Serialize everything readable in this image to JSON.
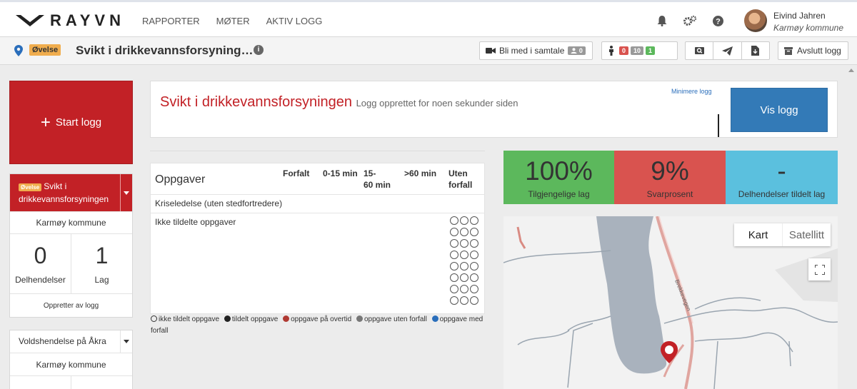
{
  "header": {
    "logo_text": "RAYVN",
    "nav": [
      "RAPPORTER",
      "MØTER",
      "AKTIV LOGG"
    ],
    "user_name": "Eivind Jahren",
    "user_org": "Karmøy kommune"
  },
  "subbar": {
    "badge": "Øvelse",
    "title": "Svikt i drikkevannsforsyning…",
    "join_label": "Bli med i samtale",
    "join_count": "0",
    "counts": [
      "0",
      "10",
      "1"
    ],
    "close_label": "Avslutt logg"
  },
  "left": {
    "start_label": "Start logg",
    "card1": {
      "badge": "Øvelse",
      "title": "Svikt i drikkevannsforsyningen",
      "org": "Karmøy kommune",
      "stats": [
        {
          "value": "0",
          "label": "Delhendelser"
        },
        {
          "value": "1",
          "label": "Lag"
        }
      ],
      "footer": "Oppretter av logg"
    },
    "card2": {
      "title": "Voldshendelse på Åkra",
      "org": "Karmøy kommune"
    }
  },
  "log_header": {
    "title": "Svikt i drikkevannsforsyningen",
    "subtitle": "Logg opprettet for noen sekunder siden",
    "minimize": "Minimere logg",
    "open_label": "Vis logg"
  },
  "tasks": {
    "title": "Oppgaver",
    "columns": [
      "Forfalt",
      "0-15 min",
      "15-\n60 min",
      ">60 min",
      "Uten\nforfall"
    ],
    "rows": [
      "Kriseledelse (uten stedfortredere)",
      "Ikke tildelte oppgaver"
    ],
    "legend": [
      {
        "label": "ikke tildelt oppgave",
        "color": "#ffffff"
      },
      {
        "label": "tildelt oppgave",
        "color": "#222222"
      },
      {
        "label": "oppgave på overtid",
        "color": "#b03a33"
      },
      {
        "label": "oppgave uten forfall",
        "color": "#777777"
      },
      {
        "label": "oppgave med forfall",
        "color": "#2a6ebb"
      }
    ]
  },
  "kpis": [
    {
      "value": "100%",
      "label": "Tilgjengelige lag",
      "color": "#5cb85c"
    },
    {
      "value": "9%",
      "label": "Svarprosent",
      "color": "#d9534f"
    },
    {
      "value": "-",
      "label": "Delhendelser tildelt lag",
      "color": "#5bc0de"
    }
  ],
  "map": {
    "toggle": [
      "Kart",
      "Satellitt"
    ],
    "road_label": "Brekkevegen"
  }
}
